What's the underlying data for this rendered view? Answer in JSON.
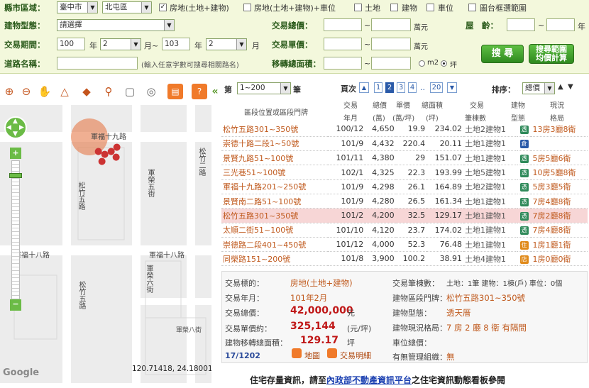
{
  "filter": {
    "county_label": "縣市區域：",
    "county_value": "臺中市",
    "district_value": "北屯區",
    "type_options": [
      {
        "label": "房地(土地+建物)",
        "checked": true
      },
      {
        "label": "房地(土地+建物)+車位",
        "checked": false
      },
      {
        "label": "土地",
        "checked": false
      },
      {
        "label": "建物",
        "checked": false
      },
      {
        "label": "車位",
        "checked": false
      }
    ],
    "map_select_label": "圖台框選範圍",
    "building_type_label": "建物型態：",
    "building_type_value": "請選擇",
    "total_price_label": "交易總價：",
    "total_price_unit": "萬元",
    "age_label": "屋　齡：",
    "age_unit": "年",
    "period_label": "交易期間：",
    "period_from_year": "100",
    "period_from_month": "2",
    "period_to_year": "103",
    "period_to_month": "2",
    "year_unit": "年",
    "month_unit": "月",
    "month_tilde_unit": "月~",
    "unit_price_label": "交易單價：",
    "unit_price_unit": "萬元",
    "road_label": "道路名稱：",
    "road_hint": "(輸入任意字數可搜尋相關路名)",
    "area_label": "移轉總面積：",
    "unit_m2": "m2",
    "unit_ping": "坪",
    "tilde": "~",
    "search_button": "搜 尋",
    "search_range_button_line1": "搜尋範圍",
    "search_range_button_line2": "均價計算"
  },
  "map": {
    "roads": [
      "軍福十九路",
      "松竹五路",
      "軍榮五街",
      "軍福十八路",
      "松竹二路",
      "軍榮六街",
      "松竹五路",
      "軍榮八街"
    ],
    "coords": "120.71418, 24.18001",
    "google": "Google"
  },
  "panel": {
    "page_label": "第",
    "page_range": "1~200",
    "page_unit": "筆",
    "pages_label": "頁次",
    "pages": [
      "1",
      "2",
      "3",
      "4",
      "..",
      "20"
    ],
    "current_page": "2",
    "sort_label": "排序：",
    "sort_value": "總價",
    "headers": [
      "區段位置或區段門牌",
      "交易年月",
      "總價(萬)",
      "單價(萬/坪)",
      "總面積(坪)",
      "交易筆棟數",
      "建物型態",
      "現況格局"
    ],
    "headers_line1": [
      "區段位置或區段門牌",
      "交易",
      "總價",
      "單價",
      "總面積",
      "交易",
      "建物",
      "現況"
    ],
    "headers_line2": [
      "",
      "年月",
      "(萬)",
      "(萬/坪)",
      "(坪)",
      "筆棟數",
      "型態",
      "格局"
    ],
    "rows": [
      {
        "addr": "松竹五路301~350號",
        "date": "100/12",
        "total": "4,650",
        "unit": "19.9",
        "area": "234.02",
        "count": "土地2建物1",
        "type": "透",
        "layout": "13房3廳8衛"
      },
      {
        "addr": "崇德十路二段1~50號",
        "date": "101/9",
        "total": "4,432",
        "unit": "220.4",
        "area": "20.11",
        "count": "土地1建物1",
        "type": "倉",
        "layout": ""
      },
      {
        "addr": "景賢九路51~100號",
        "date": "101/11",
        "total": "4,380",
        "unit": "29",
        "area": "151.07",
        "count": "土地1建物1",
        "type": "透",
        "layout": "5房5廳6衛"
      },
      {
        "addr": "三光巷51~100號",
        "date": "102/1",
        "total": "4,325",
        "unit": "22.3",
        "area": "193.99",
        "count": "土地5建物1",
        "type": "透",
        "layout": "10房5廳8衛"
      },
      {
        "addr": "軍福十九路201~250號",
        "date": "101/9",
        "total": "4,298",
        "unit": "26.1",
        "area": "164.89",
        "count": "土地2建物1",
        "type": "透",
        "layout": "5房3廳5衛"
      },
      {
        "addr": "景賢南二路51~100號",
        "date": "101/9",
        "total": "4,280",
        "unit": "26.5",
        "area": "161.34",
        "count": "土地1建物1",
        "type": "透",
        "layout": "7房4廳8衛"
      },
      {
        "addr": "松竹五路301~350號",
        "date": "101/2",
        "total": "4,200",
        "unit": "32.5",
        "area": "129.17",
        "count": "土地1建物1",
        "type": "透",
        "layout": "7房2廳8衛"
      },
      {
        "addr": "太順二街51~100號",
        "date": "101/10",
        "total": "4,120",
        "unit": "23.7",
        "area": "174.02",
        "count": "土地1建物1",
        "type": "透",
        "layout": "7房4廳8衛"
      },
      {
        "addr": "崇德路二段401~450號",
        "date": "101/12",
        "total": "4,000",
        "unit": "52.3",
        "area": "76.48",
        "count": "土地1建物1",
        "type": "住",
        "layout": "1房1廳1衛"
      },
      {
        "addr": "同榮路151~200號",
        "date": "101/8",
        "total": "3,900",
        "unit": "100.2",
        "area": "38.91",
        "count": "土地4建物1",
        "type": "店",
        "layout": "1房0廳0衛"
      }
    ],
    "highlight_row": 6
  },
  "detail": {
    "target_label": "交易標的：",
    "target_value": "房地(土地+建物)",
    "date_label": "交易年月：",
    "date_value": "101年2月",
    "total_label": "交易總價：",
    "total_value": "42,000,000",
    "total_unit": "元",
    "unit_label": "交易單價約：",
    "unit_value": "325,144",
    "unit_unit": "(元/坪)",
    "area_label": "建物移轉總面積：",
    "area_value": "129.17",
    "area_unit": "坪",
    "index": "17/1202",
    "map_link": "地圖",
    "detail_link": "交易明細",
    "count_label": "交易筆棟數：",
    "count_value": "土地：1筆 建物：1棟(戶) 車位：0個",
    "addr_label": "建物區段門牌：",
    "addr_value": "松竹五路301~350號",
    "type_label": "建物型態：",
    "type_value": "透天厝",
    "layout_label": "建物現況格局：",
    "layout_value": "7 房 2 廳 8 衛 有隔間",
    "parking_label": "車位總價：",
    "mgmt_label": "有無管理組織：",
    "mgmt_value": "無"
  },
  "footer": {
    "text_before": "住宅存量資訊，請至",
    "link": "內政部不動產資訊平台",
    "text_after": "之住宅資訊動態看板參閱"
  }
}
